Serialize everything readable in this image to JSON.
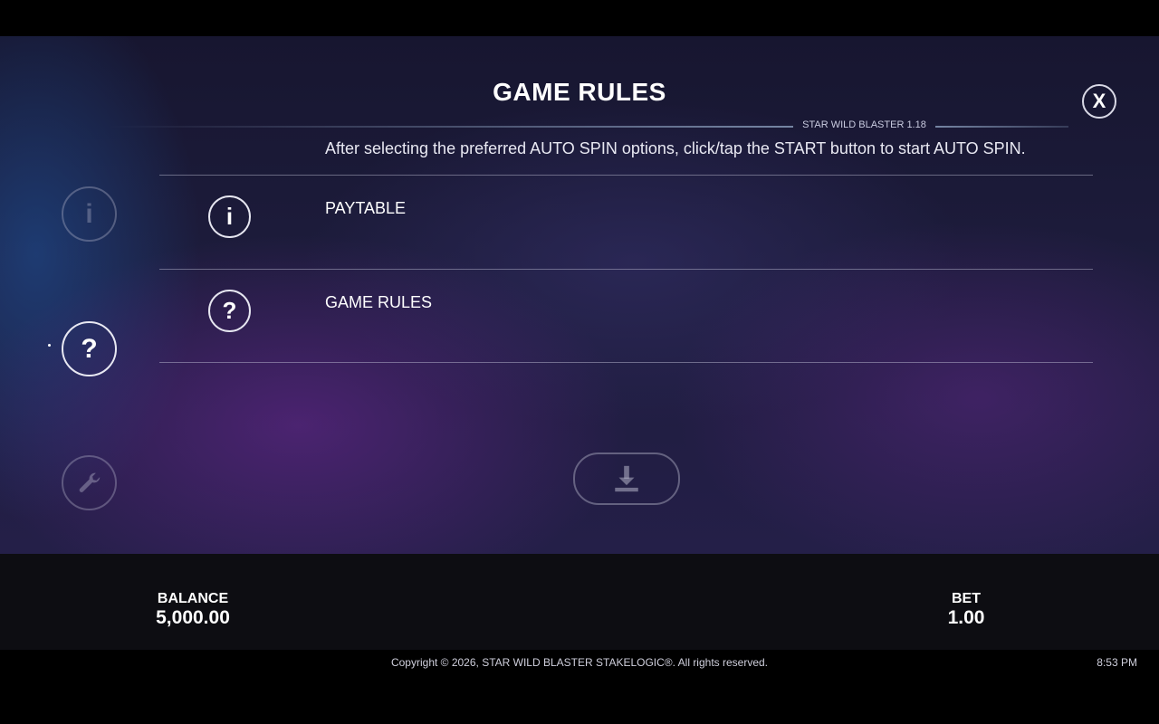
{
  "header": {
    "title": "GAME RULES",
    "version": "STAR WILD BLASTER 1.18",
    "close_label": "X"
  },
  "content": {
    "partial_text": "After selecting the preferred AUTO SPIN options, click/tap the START button to start AUTO SPIN.",
    "menu": [
      {
        "label": "PAYTABLE",
        "icon": "info-icon",
        "glyph": "i"
      },
      {
        "label": "GAME RULES",
        "icon": "question-icon",
        "glyph": "?"
      }
    ]
  },
  "sidebar": {
    "items": [
      {
        "icon": "info-icon",
        "glyph": "i",
        "active": false
      },
      {
        "icon": "question-icon",
        "glyph": "?",
        "active": true
      },
      {
        "icon": "wrench-icon",
        "active": false
      }
    ]
  },
  "download": {
    "icon": "download-icon"
  },
  "status": {
    "balance_label": "BALANCE",
    "balance_value": "5,000.00",
    "bet_label": "BET",
    "bet_value": "1.00"
  },
  "footer": {
    "copyright": "Copyright © 2026, STAR WILD BLASTER STAKELOGIC®. All rights reserved.",
    "time": "8:53 PM"
  }
}
